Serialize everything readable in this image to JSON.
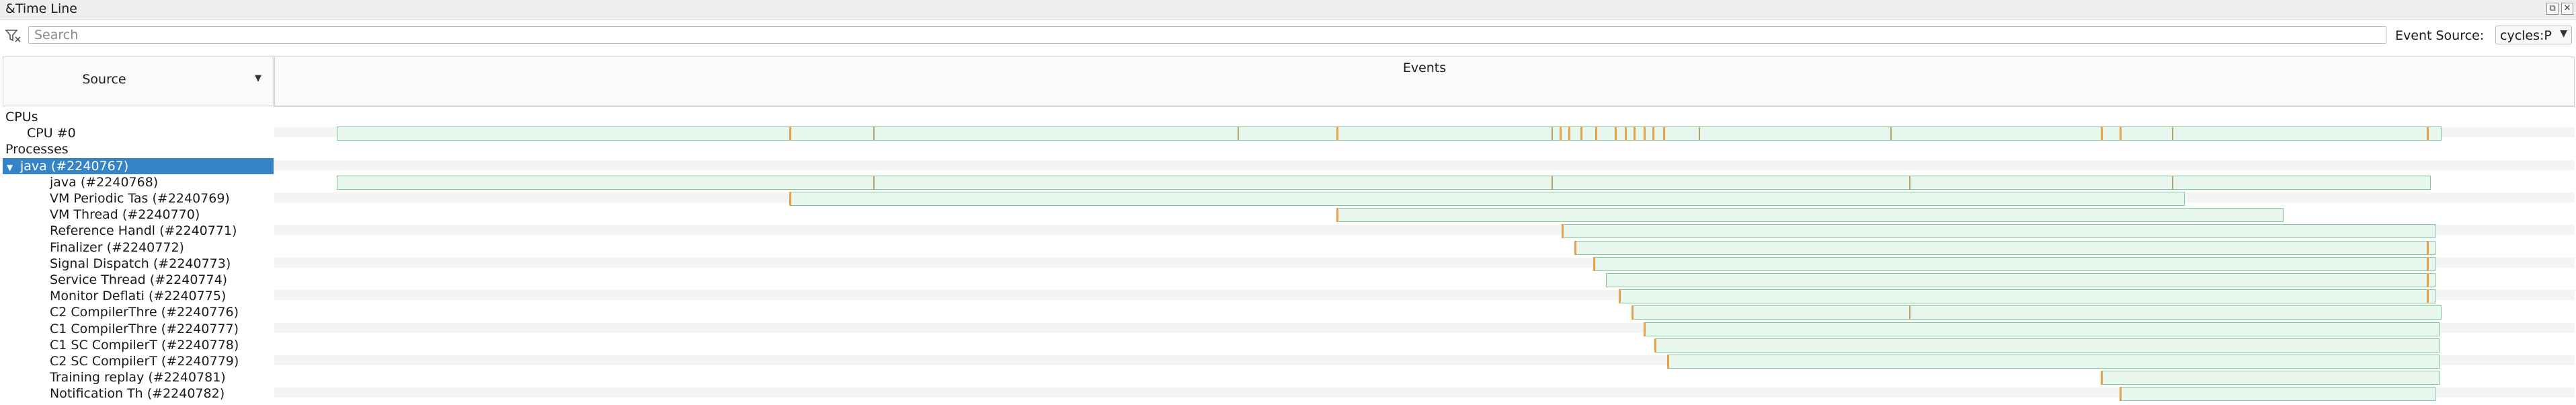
{
  "window": {
    "title": "&Time Line"
  },
  "search": {
    "placeholder": "Search",
    "value": ""
  },
  "event_source": {
    "label": "Event Source:",
    "value": "cycles:P"
  },
  "columns": {
    "source": "Source",
    "events": "Events"
  },
  "tree": [
    {
      "label": "CPUs",
      "indent": 0,
      "kind": "group"
    },
    {
      "label": "CPU #0",
      "indent": 1,
      "kind": "cpu",
      "track": [
        0.0,
        1.0
      ],
      "markers": [
        {
          "t": 0.215,
          "c": "o"
        },
        {
          "t": 0.255,
          "c": "g"
        },
        {
          "t": 0.428,
          "c": "g"
        },
        {
          "t": 0.475,
          "c": "o"
        },
        {
          "t": 0.577,
          "c": "g"
        },
        {
          "t": 0.581,
          "c": "o"
        },
        {
          "t": 0.585,
          "c": "o"
        },
        {
          "t": 0.591,
          "c": "o"
        },
        {
          "t": 0.598,
          "c": "o"
        },
        {
          "t": 0.607,
          "c": "o"
        },
        {
          "t": 0.612,
          "c": "o"
        },
        {
          "t": 0.616,
          "c": "o"
        },
        {
          "t": 0.621,
          "c": "o"
        },
        {
          "t": 0.625,
          "c": "o"
        },
        {
          "t": 0.63,
          "c": "o"
        },
        {
          "t": 0.647,
          "c": "g"
        },
        {
          "t": 0.738,
          "c": "g"
        },
        {
          "t": 0.838,
          "c": "o"
        },
        {
          "t": 0.847,
          "c": "o"
        },
        {
          "t": 0.872,
          "c": "g"
        },
        {
          "t": 0.993,
          "c": "o"
        }
      ]
    },
    {
      "label": "Processes",
      "indent": 0,
      "kind": "group"
    },
    {
      "label": "java (#2240767)",
      "indent": 0,
      "kind": "process",
      "selected": true,
      "expanded": true
    },
    {
      "label": "java (#2240768)",
      "indent": 2,
      "kind": "thread",
      "track": [
        0.0,
        0.995
      ],
      "markers": [
        {
          "t": 0.255,
          "c": "g"
        },
        {
          "t": 0.577,
          "c": "g"
        },
        {
          "t": 0.747,
          "c": "g"
        },
        {
          "t": 0.872,
          "c": "g"
        }
      ]
    },
    {
      "label": "VM Periodic Tas (#2240769)",
      "indent": 2,
      "kind": "thread",
      "track": [
        0.215,
        0.878
      ],
      "markers": [
        {
          "t": 0.215,
          "c": "o"
        }
      ]
    },
    {
      "label": "VM Thread (#2240770)",
      "indent": 2,
      "kind": "thread",
      "track": [
        0.475,
        0.925
      ],
      "markers": [
        {
          "t": 0.475,
          "c": "o"
        }
      ]
    },
    {
      "label": "Reference Handl (#2240771)",
      "indent": 2,
      "kind": "thread",
      "track": [
        0.582,
        0.997
      ],
      "markers": [
        {
          "t": 0.582,
          "c": "o"
        }
      ]
    },
    {
      "label": "Finalizer (#2240772)",
      "indent": 2,
      "kind": "thread",
      "track": [
        0.588,
        0.997
      ],
      "markers": [
        {
          "t": 0.588,
          "c": "o"
        },
        {
          "t": 0.993,
          "c": "o"
        }
      ]
    },
    {
      "label": "Signal Dispatch (#2240773)",
      "indent": 2,
      "kind": "thread",
      "track": [
        0.597,
        0.997
      ],
      "markers": [
        {
          "t": 0.597,
          "c": "o"
        },
        {
          "t": 0.993,
          "c": "o"
        }
      ]
    },
    {
      "label": "Service Thread (#2240774)",
      "indent": 2,
      "kind": "thread",
      "track": [
        0.603,
        0.997
      ],
      "markers": [
        {
          "t": 0.993,
          "c": "o"
        }
      ]
    },
    {
      "label": "Monitor Deflati (#2240775)",
      "indent": 2,
      "kind": "thread",
      "track": [
        0.609,
        0.997
      ],
      "markers": [
        {
          "t": 0.609,
          "c": "o"
        },
        {
          "t": 0.993,
          "c": "o"
        }
      ]
    },
    {
      "label": "C2 CompilerThre (#2240776)",
      "indent": 2,
      "kind": "thread",
      "track": [
        0.615,
        1.0
      ],
      "markers": [
        {
          "t": 0.615,
          "c": "o"
        },
        {
          "t": 0.747,
          "c": "g"
        }
      ]
    },
    {
      "label": "C1 CompilerThre (#2240777)",
      "indent": 2,
      "kind": "thread",
      "track": [
        0.621,
        0.999
      ],
      "markers": [
        {
          "t": 0.621,
          "c": "o"
        }
      ]
    },
    {
      "label": "C1 SC CompilerT (#2240778)",
      "indent": 2,
      "kind": "thread",
      "track": [
        0.626,
        0.999
      ],
      "markers": [
        {
          "t": 0.626,
          "c": "o"
        }
      ]
    },
    {
      "label": "C2 SC CompilerT (#2240779)",
      "indent": 2,
      "kind": "thread",
      "track": [
        0.632,
        0.999
      ],
      "markers": [
        {
          "t": 0.632,
          "c": "o"
        }
      ]
    },
    {
      "label": "Training replay (#2240781)",
      "indent": 2,
      "kind": "thread",
      "track": [
        0.838,
        0.999
      ],
      "markers": [
        {
          "t": 0.838,
          "c": "o"
        }
      ]
    },
    {
      "label": "Notification Th (#2240782)",
      "indent": 2,
      "kind": "thread",
      "track": [
        0.847,
        0.997
      ],
      "markers": [
        {
          "t": 0.847,
          "c": "o"
        }
      ]
    }
  ]
}
